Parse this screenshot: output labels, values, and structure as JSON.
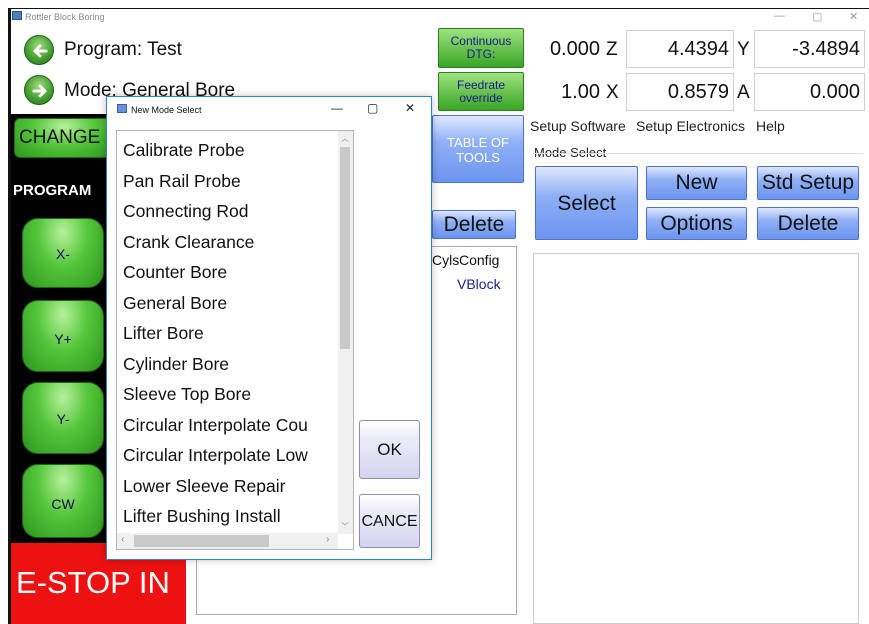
{
  "window": {
    "title": "Rottler Block Boring",
    "controls": [
      "—",
      "▢",
      "✕"
    ]
  },
  "program": {
    "label": "Program: Test"
  },
  "mode": {
    "label": "Mode: General Bore"
  },
  "buttons_top": {
    "continuous": [
      "Continuous",
      "DTG:"
    ],
    "feedrate": [
      "Feedrate",
      "override"
    ]
  },
  "dro": {
    "z_value": "0.000",
    "z_axis": "Z",
    "y_value": "4.4394",
    "y_axis": "Y",
    "y2_value": "-3.4894",
    "x_value": "1.00",
    "x_axis": "X",
    "x2_value": "0.8579",
    "a_axis": "A",
    "a_value": "0.000"
  },
  "menu": {
    "items": [
      "Setup Software",
      "Setup Electronics",
      "Help"
    ]
  },
  "mode_select": {
    "label": "Mode Select",
    "select": "Select",
    "new": "New",
    "std_setup": "Std Setup",
    "options": "Options",
    "delete": "Delete"
  },
  "table_of_tools": [
    "TABLE OF",
    "TOOLS"
  ],
  "delete_bg": "Delete",
  "bg_columns": {
    "cyls": "Cyls",
    "config": "Config",
    "vblock": "VBlock"
  },
  "left_panel": {
    "change": "CHANGE",
    "program": "PROGRAM",
    "x_minus": "X-",
    "y_plus": "Y+",
    "y_minus": "Y-",
    "cw": "CW",
    "estop": "E-STOP IN"
  },
  "dialog": {
    "title": "New Mode Select",
    "controls": [
      "—",
      "▢",
      "✕"
    ],
    "items": [
      "Calibrate Probe",
      "Pan Rail Probe",
      "Connecting Rod",
      "Crank Clearance",
      "Counter Bore",
      "General Bore",
      "Lifter Bore",
      "Cylinder Bore",
      "Sleeve Top Bore",
      "Circular Interpolate Cou",
      "Circular Interpolate Low",
      "Lower Sleeve Repair",
      "Lifter Bushing Install"
    ],
    "ok": "OK",
    "cancel": "CANCE"
  },
  "colors": {
    "green": "#3f9c2e",
    "blue": "#6d95f0",
    "estop": "#ee1111",
    "dialog_border": "#2f7fd8"
  }
}
